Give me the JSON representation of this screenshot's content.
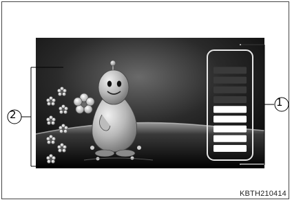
{
  "callouts": {
    "one": "①",
    "two": "②"
  },
  "figure_code": "KBTH210414",
  "gauge": {
    "segments_total": 9,
    "segments_lit": 5,
    "lit_color": "#ffffff",
    "unlit_color": "#3a3a3a"
  },
  "icons": {
    "character": "mascot-icon",
    "flower": "flower-icon"
  }
}
